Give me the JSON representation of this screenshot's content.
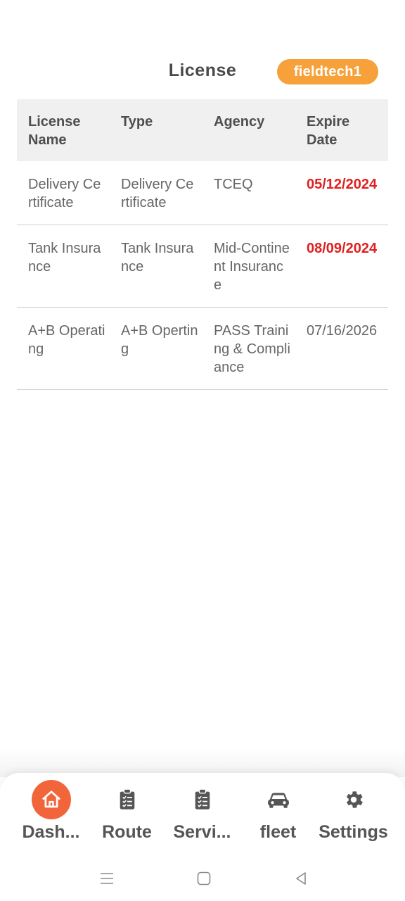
{
  "header": {
    "title": "License",
    "username": "fieldtech1"
  },
  "table": {
    "columns": [
      "License Name",
      "Type",
      "Agency",
      "Expire Date"
    ],
    "rows": [
      {
        "license_name": "Delivery Certificate",
        "type": "Delivery Certificate",
        "agency": "TCEQ",
        "expire_date": "05/12/2024",
        "expired": true
      },
      {
        "license_name": "Tank Insurance",
        "type": "Tank Insurance",
        "agency": "Mid-Continent Insurance",
        "expire_date": "08/09/2024",
        "expired": true
      },
      {
        "license_name": "A+B Operating",
        "type": "A+B Operting",
        "agency": "PASS Training & Compliance",
        "expire_date": "07/16/2026",
        "expired": false
      }
    ]
  },
  "bottom_nav": {
    "items": [
      {
        "label": "Dash...",
        "icon": "home-icon",
        "active": true
      },
      {
        "label": "Route",
        "icon": "clipboard-icon",
        "active": false
      },
      {
        "label": "Servi...",
        "icon": "clipboard-icon",
        "active": false
      },
      {
        "label": "fleet",
        "icon": "car-icon",
        "active": false
      },
      {
        "label": "Settings",
        "icon": "gear-icon",
        "active": false
      }
    ]
  },
  "colors": {
    "accent": "#f2643a",
    "badge": "#f7a13a",
    "expired_text": "#e02020",
    "header_bg": "#f0f0f0"
  }
}
